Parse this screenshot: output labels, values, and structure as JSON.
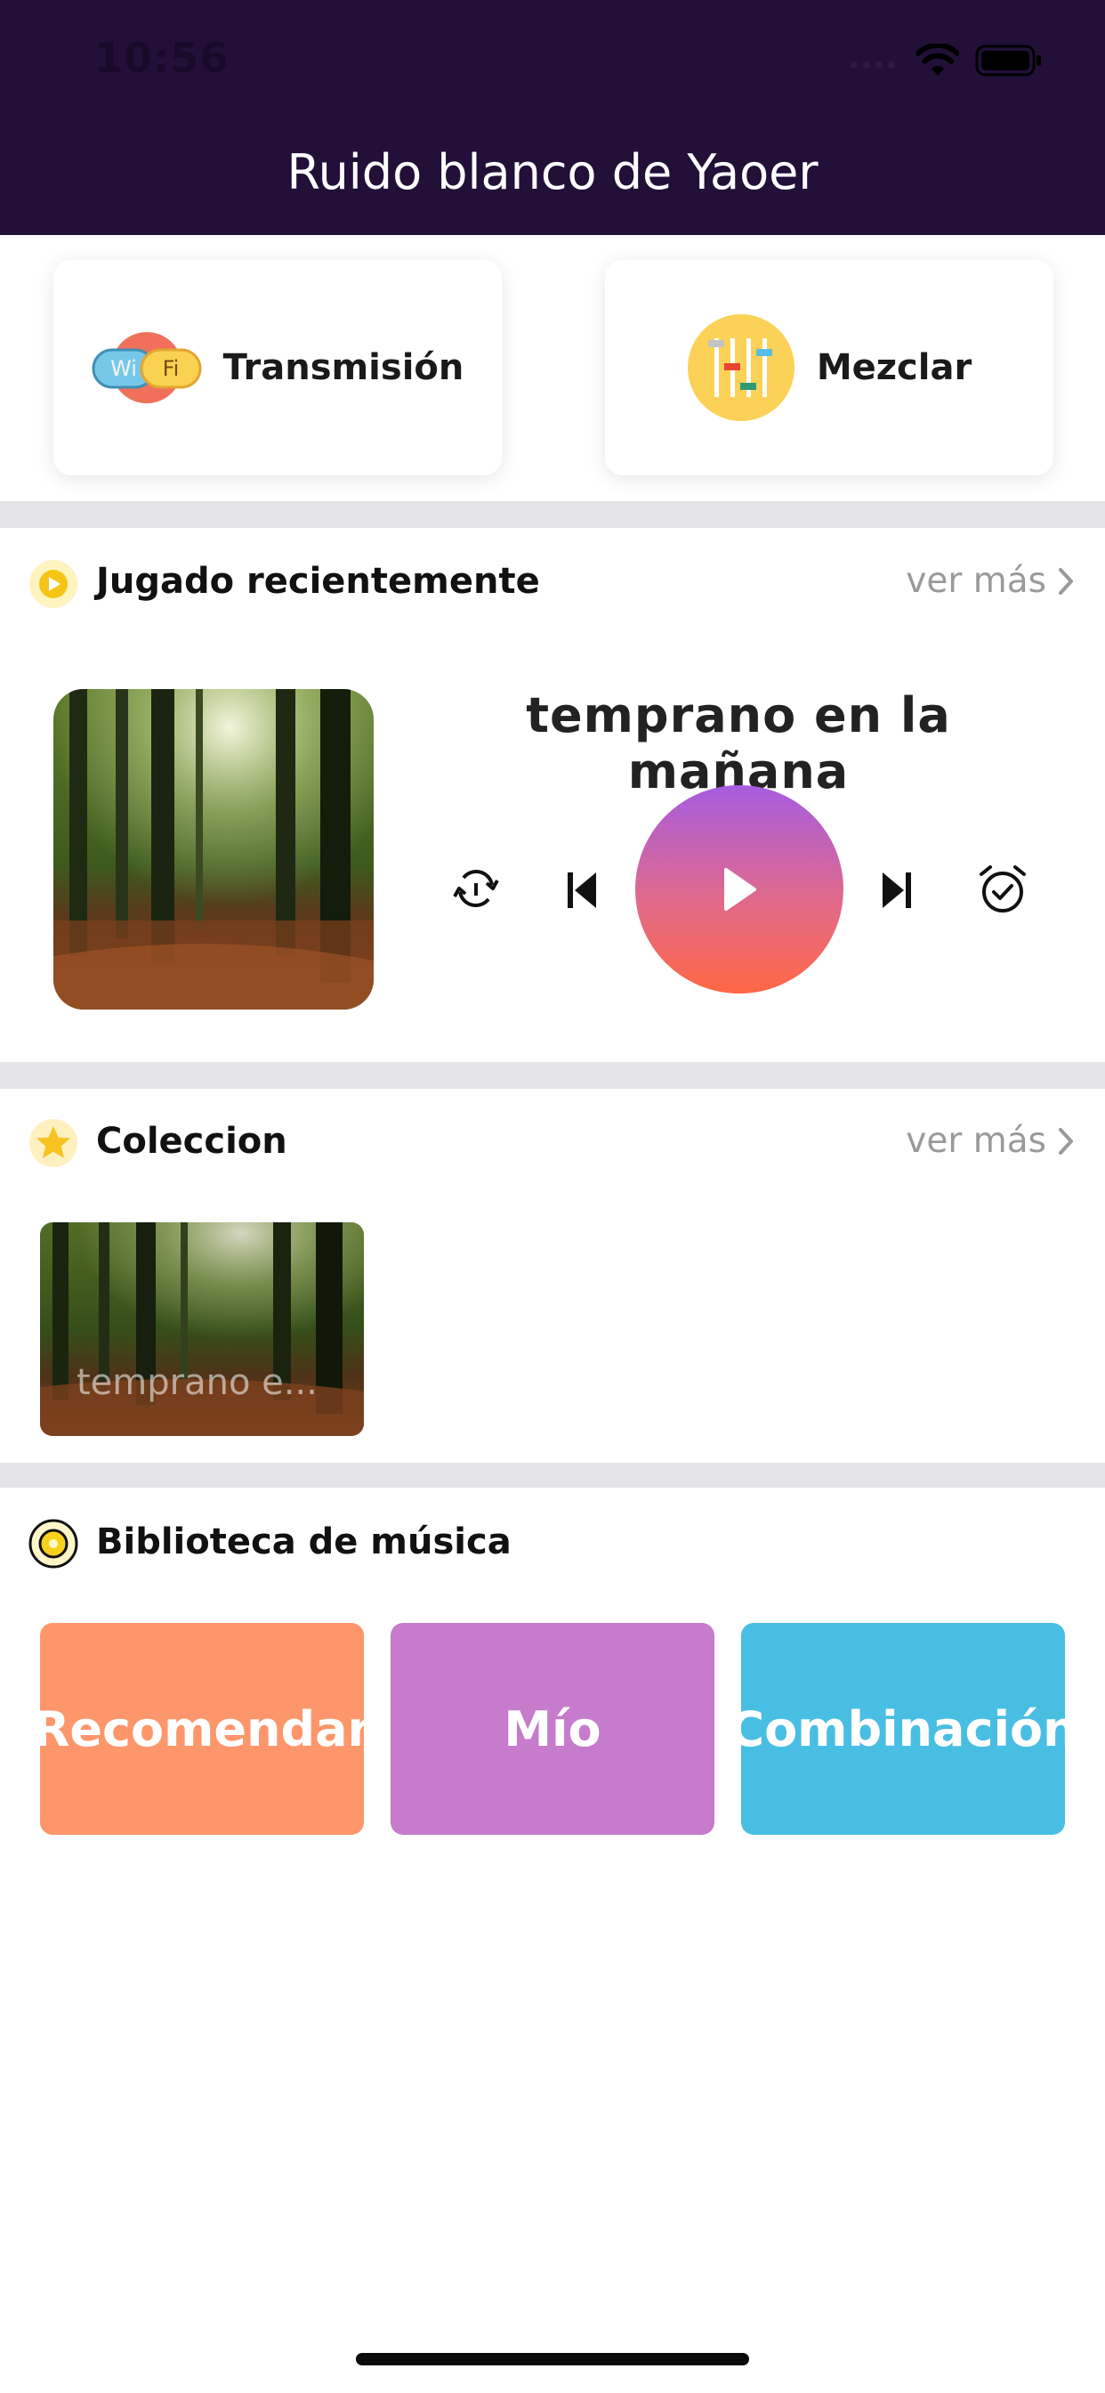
{
  "status_bar": {
    "time": "10:56"
  },
  "header": {
    "title": "Ruido blanco de Yaoer"
  },
  "top_cards": [
    {
      "label": "Transmisión",
      "icon": "wifi-icon",
      "icon_text_left": "Wi",
      "icon_text_right": "Fi"
    },
    {
      "label": "Mezclar",
      "icon": "mixer-icon"
    }
  ],
  "recent": {
    "title": "Jugado recientemente",
    "more": "ver más",
    "track_title": "temprano en la mañana",
    "controls": [
      "repeat-icon",
      "previous-icon",
      "play-icon",
      "next-icon",
      "alarm-icon"
    ]
  },
  "collection": {
    "title": "Coleccion",
    "more": "ver más",
    "items": [
      {
        "caption": "temprano e..."
      }
    ]
  },
  "library": {
    "title": "Biblioteca de música",
    "tiles": [
      {
        "label": "Recomendar",
        "color": "#fd976b"
      },
      {
        "label": "Mío",
        "color": "#c67bcc"
      },
      {
        "label": "Combinación",
        "color": "#49bee3"
      }
    ]
  },
  "colors": {
    "header_bg": "#221038",
    "separator": "#e4e4e8",
    "play_gradient_top": "#a65ce0",
    "play_gradient_bottom": "#ff6745"
  }
}
